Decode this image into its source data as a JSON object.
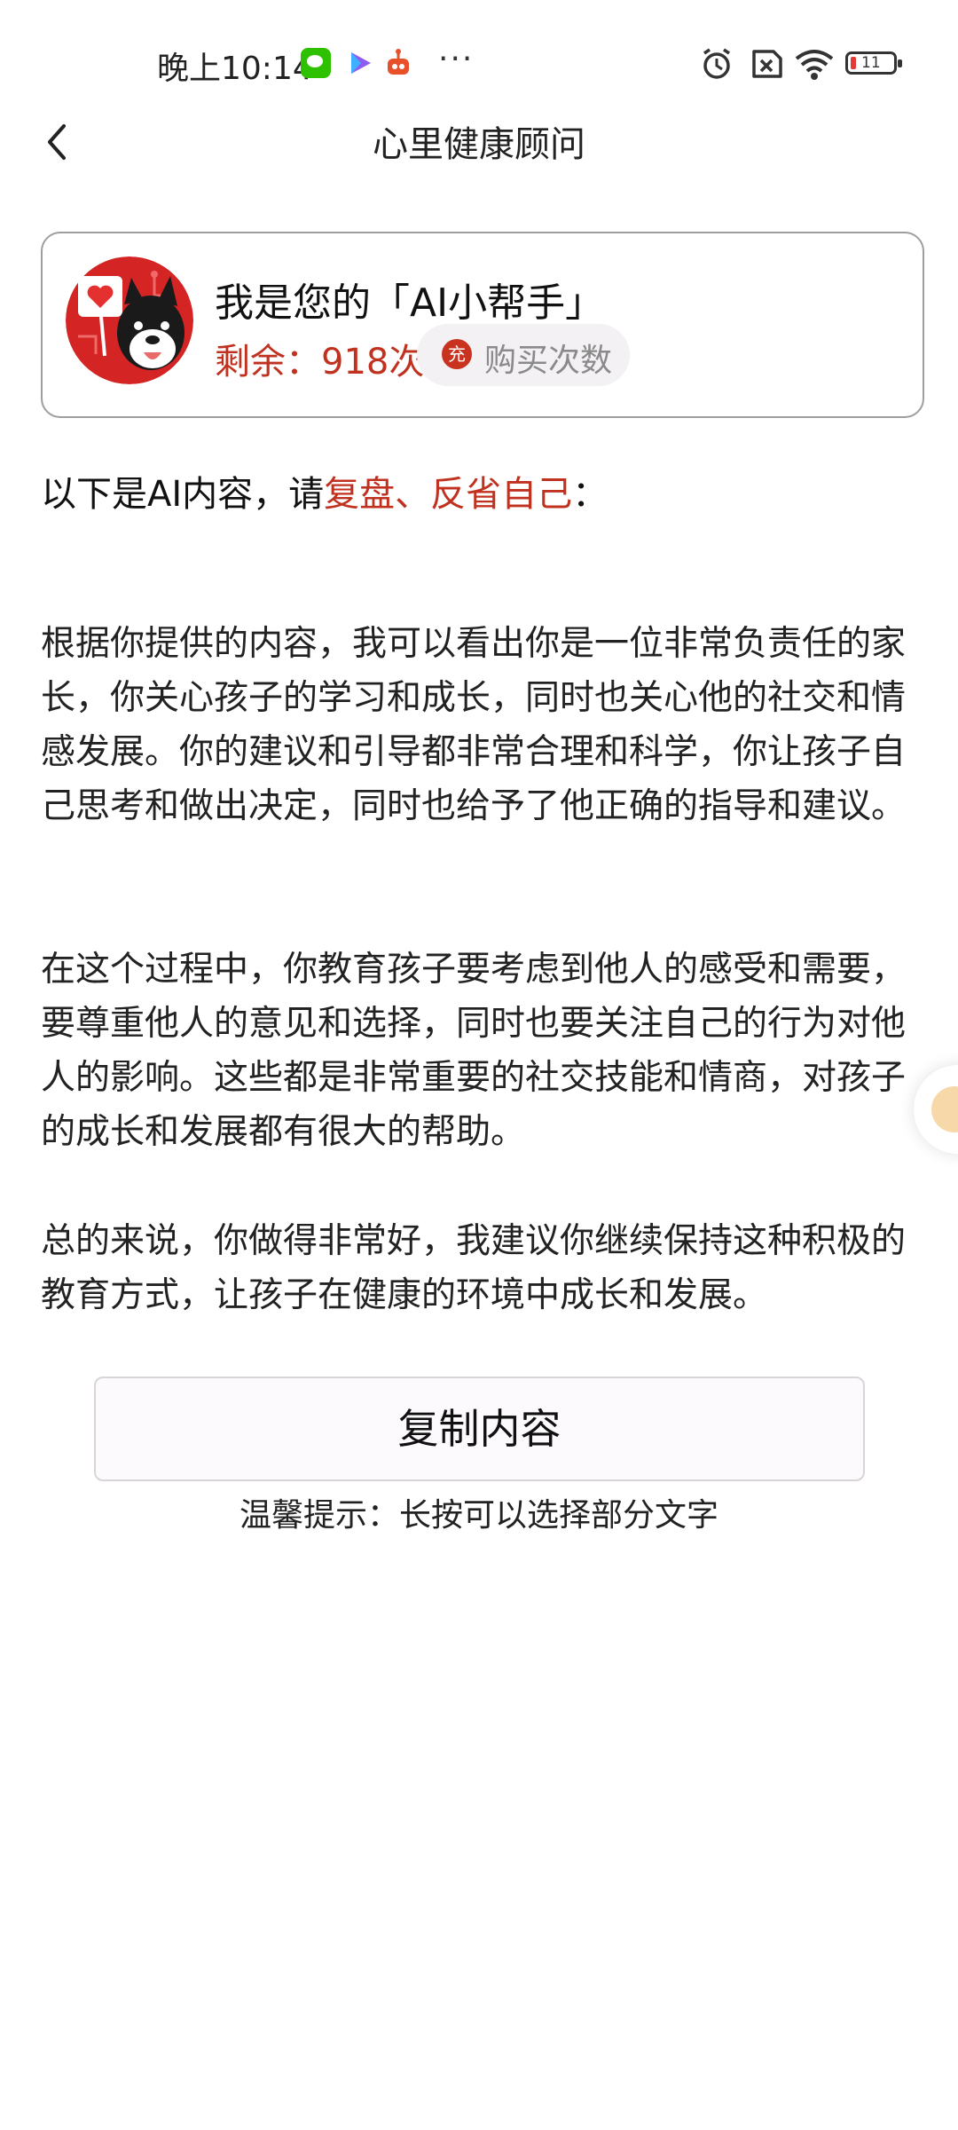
{
  "status_bar": {
    "time": "晚上10:14",
    "more": "···",
    "battery_level": "11",
    "icons": [
      "wechat-icon",
      "play-icon",
      "robot-icon",
      "alarm-icon",
      "sim-off-icon",
      "wifi-icon",
      "battery-icon"
    ]
  },
  "header": {
    "title": "心里健康顾问",
    "back_icon": "chevron-left-icon"
  },
  "assistant_card": {
    "title": "我是您的「AI小帮手」",
    "remaining": "剩余：918次",
    "buy_icon_text": "充",
    "buy_label": "购买次数"
  },
  "intro": {
    "prefix": "以下是AI内容，请",
    "highlight": "复盘、反省自己",
    "suffix": "："
  },
  "content": {
    "paragraphs": [
      "根据你提供的内容，我可以看出你是一位非常负责任的家长，你关心孩子的学习和成长，同时也关心他的社交和情感发展。你的建议和引导都非常合理和科学，你让孩子自己思考和做出决定，同时也给予了他正确的指导和建议。",
      "在这个过程中，你教育孩子要考虑到他人的感受和需要，要尊重他人的意见和选择，同时也要关注自己的行为对他人的影响。这些都是非常重要的社交技能和情商，对孩子的成长和发展都有很大的帮助。",
      "总的来说，你做得非常好，我建议你继续保持这种积极的教育方式，让孩子在健康的环境中成长和发展。"
    ]
  },
  "actions": {
    "copy_label": "复制内容",
    "tip": "温馨提示：长按可以选择部分文字"
  },
  "colors": {
    "accent_red": "#c0321f",
    "card_border": "#9e9e9e",
    "buy_bg": "#f4f1f5"
  }
}
